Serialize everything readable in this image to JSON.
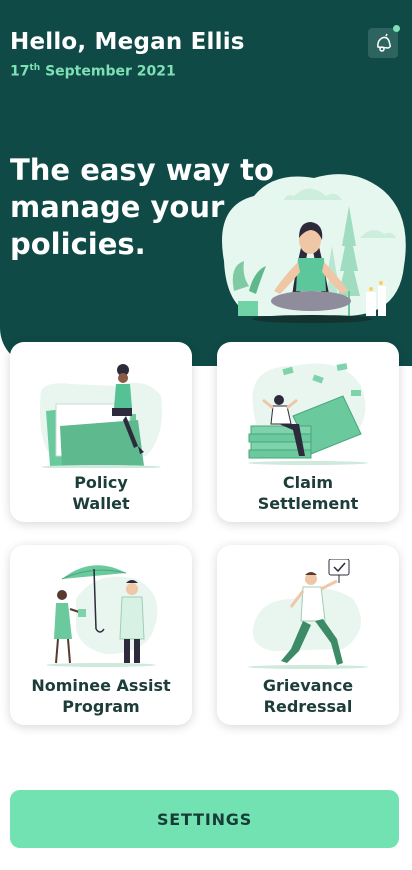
{
  "header": {
    "greeting": "Hello, Megan Ellis",
    "date_day": "17",
    "date_suffix": "th",
    "date_rest": " September 2021",
    "notification_icon": "bell-icon",
    "notification_badge": true
  },
  "hero": {
    "headline": "The easy way to manage your policies.",
    "illustration": "meditation-illustration"
  },
  "cards": [
    {
      "label_line1": "Policy",
      "label_line2": "Wallet",
      "illustration": "folder-illustration"
    },
    {
      "label_line1": "Claim",
      "label_line2": "Settlement",
      "illustration": "money-stack-illustration"
    },
    {
      "label_line1": "Nominee Assist",
      "label_line2": "Program",
      "illustration": "umbrella-illustration"
    },
    {
      "label_line1": "Grievance",
      "label_line2": "Redressal",
      "illustration": "running-man-illustration"
    }
  ],
  "settings_button": {
    "label": "SETTINGS"
  },
  "colors": {
    "hero_background": "#0f4a47",
    "accent": "#72e2b2",
    "date_text": "#7fe0b4",
    "card_text": "#1d3d3a"
  }
}
